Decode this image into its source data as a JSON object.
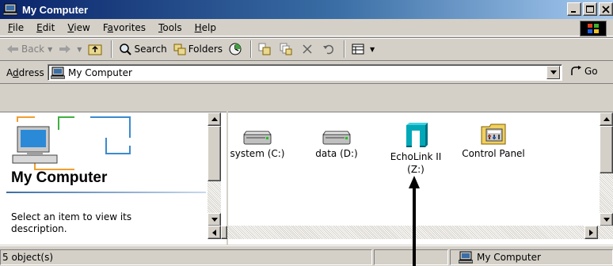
{
  "window": {
    "title": "My Computer"
  },
  "menu": {
    "items": [
      {
        "label": "File",
        "ul": "F",
        "rest": "ile"
      },
      {
        "label": "Edit",
        "ul": "E",
        "rest": "dit"
      },
      {
        "label": "View",
        "ul": "V",
        "rest": "iew"
      },
      {
        "label": "Favorites",
        "pre": "F",
        "ul": "a",
        "rest": "vorites"
      },
      {
        "label": "Tools",
        "ul": "T",
        "rest": "ools"
      },
      {
        "label": "Help",
        "ul": "H",
        "rest": "elp"
      }
    ]
  },
  "toolbar": {
    "back": "Back",
    "search": "Search",
    "folders": "Folders"
  },
  "address": {
    "label_pre": "A",
    "label_ul": "d",
    "label_rest": "dress",
    "value": "My Computer",
    "go": "Go"
  },
  "left_pane": {
    "title": "My Computer",
    "description": "Select an item to view its description."
  },
  "items": [
    {
      "label": "system (C:)",
      "icon": "hard-drive-icon"
    },
    {
      "label": "data (D:)",
      "icon": "hard-drive-icon"
    },
    {
      "label_line1": "EchoLink II",
      "label_line2": "(Z:)",
      "icon": "echolink-drive-icon"
    },
    {
      "label": "Control Panel",
      "icon": "control-panel-icon"
    }
  ],
  "status": {
    "objects": "5 object(s)",
    "location": "My Computer"
  },
  "colors": {
    "title_start": "#0a246a",
    "title_end": "#a6caf0",
    "chrome": "#d4d0c8",
    "echolink": "#00a8b8"
  }
}
